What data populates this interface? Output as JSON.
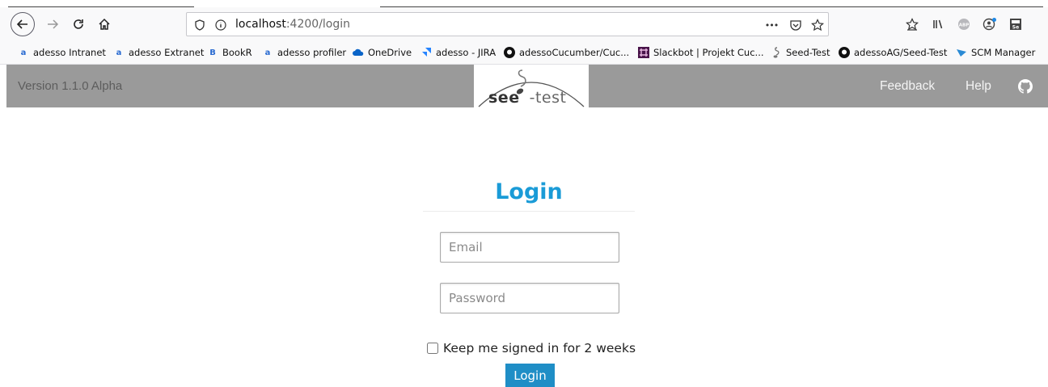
{
  "browser": {
    "url_host": "localhost",
    "url_path": ":4200/login",
    "page_actions": "•••"
  },
  "bookmarks": [
    {
      "label": "adesso Intranet",
      "icon": "adesso-icon",
      "color": "#2a6bd1"
    },
    {
      "label": "adesso Extranet",
      "icon": "adesso-icon",
      "color": "#2a6bd1"
    },
    {
      "label": "BookR",
      "icon": "bookr-icon",
      "color": "#2a6bd1"
    },
    {
      "label": "adesso profiler",
      "icon": "adesso-icon",
      "color": "#2a6bd1"
    },
    {
      "label": "OneDrive",
      "icon": "cloud-icon",
      "color": "#0a64c8"
    },
    {
      "label": "adesso - JIRA",
      "icon": "jira-icon",
      "color": "#2684ff"
    },
    {
      "label": "adessoCucumber/Cuc...",
      "icon": "github-icon",
      "color": "#111111"
    },
    {
      "label": "Slackbot | Projekt Cuc...",
      "icon": "slack-icon",
      "color": "#4a154b"
    },
    {
      "label": "Seed-Test",
      "icon": "seed-icon",
      "color": "#666666"
    },
    {
      "label": "adessoAG/Seed-Test",
      "icon": "github-icon",
      "color": "#111111"
    },
    {
      "label": "SCM Manager",
      "icon": "scm-icon",
      "color": "#2a8ad4"
    }
  ],
  "header": {
    "version": "Version 1.1.0 Alpha",
    "logo_seed": "see",
    "logo_test": "-test",
    "feedback": "Feedback",
    "help": "Help"
  },
  "login": {
    "title": "Login",
    "email_placeholder": "Email",
    "password_placeholder": "Password",
    "remember_label": "Keep me signed in for 2 weeks",
    "button_label": "Login"
  },
  "colors": {
    "accent": "#1a9bd7",
    "button": "#1f8ec6",
    "header_bg": "#9a9a9a"
  }
}
